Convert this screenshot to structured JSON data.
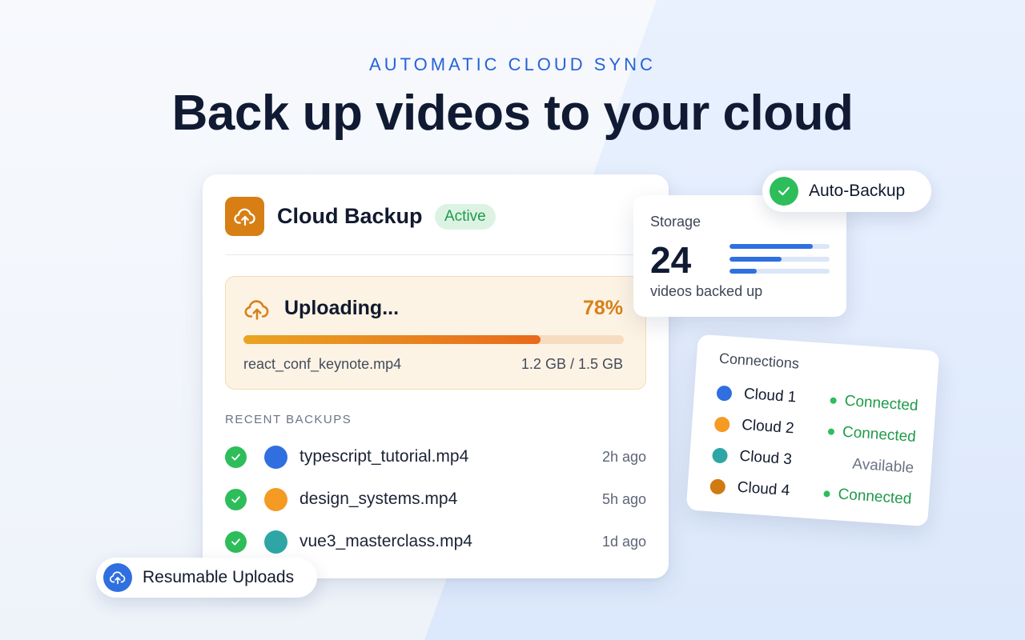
{
  "hero": {
    "eyebrow": "AUTOMATIC CLOUD SYNC",
    "headline": "Back up videos to your cloud"
  },
  "main_card": {
    "icon": "cloud-upload-icon",
    "title": "Cloud Backup",
    "badge": "Active",
    "upload": {
      "label": "Uploading...",
      "percent_text": "78%",
      "progress": 0.78,
      "file_name": "react_conf_keynote.mp4",
      "size_text": "1.2 GB / 1.5 GB"
    },
    "recent_heading": "RECENT BACKUPS",
    "recent": [
      {
        "name": "typescript_tutorial.mp4",
        "time": "2h ago",
        "color": "#2f6fe0"
      },
      {
        "name": "design_systems.mp4",
        "time": "5h ago",
        "color": "#f59a23"
      },
      {
        "name": "vue3_masterclass.mp4",
        "time": "1d ago",
        "color": "#2fa6a6"
      }
    ]
  },
  "storage": {
    "label": "Storage",
    "count": "24",
    "sub": "videos backed up",
    "bars": [
      0.83,
      0.52,
      0.27
    ]
  },
  "auto_backup": {
    "label": "Auto-Backup",
    "icon": "check-icon"
  },
  "connections": {
    "title": "Connections",
    "items": [
      {
        "name": "Cloud 1",
        "status": "Connected",
        "connected": true,
        "color": "#2f6fe0"
      },
      {
        "name": "Cloud 2",
        "status": "Connected",
        "connected": true,
        "color": "#f59a23"
      },
      {
        "name": "Cloud 3",
        "status": "Available",
        "connected": false,
        "color": "#2fa6a6"
      },
      {
        "name": "Cloud 4",
        "status": "Connected",
        "connected": true,
        "color": "#d07a12"
      }
    ]
  },
  "resumable": {
    "label": "Resumable Uploads",
    "icon": "cloud-upload-icon"
  },
  "colors": {
    "accent_blue": "#2563d8",
    "success_green": "#2ebd5b",
    "upload_orange": "#d6801a"
  }
}
